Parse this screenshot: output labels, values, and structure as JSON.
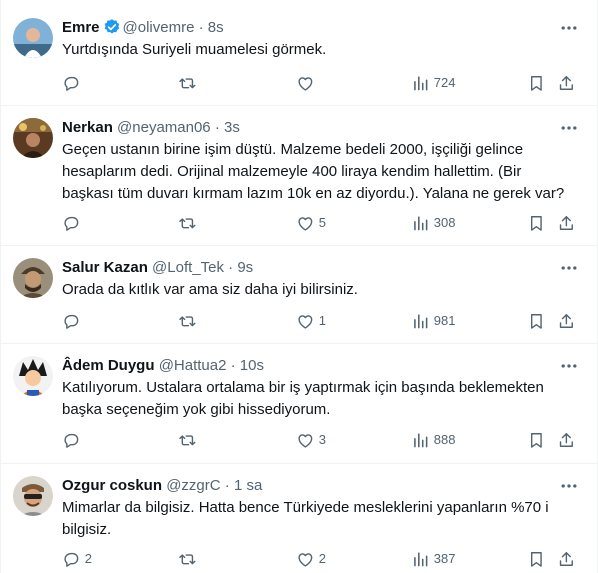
{
  "tweets": [
    {
      "name": "Emre",
      "verified": true,
      "handle": "@olivemre",
      "time": "8s",
      "text": "Yurtdışında Suriyeli muamelesi görmek.",
      "replies": "",
      "retweets": "",
      "likes": "",
      "views": "724"
    },
    {
      "name": "Nerkan",
      "verified": false,
      "handle": "@neyaman06",
      "time": "3s",
      "text": "Geçen ustanın birine işim düştü. Malzeme bedeli 2000, işçiliği gelince hesapların dedi. Orijinal malzemeyle 400 liraya kendim hallettim. (Bir başkası tüm duvarı kırmam lazım 10k en az diyordu.). Yalana ne gerek var?",
      "text_lines": [
        "Geçen ustanın birine işim düştü. Malzeme bedeli 2000, işçiliği gelince",
        "hesaplarım dedi. Orijinal malzemeyle 400 liraya kendim hallettim. (Bir",
        "başkası tüm duvarı kırmam lazım 10k en az diyordu.). Yalana ne gerek var?"
      ],
      "replies": "",
      "retweets": "",
      "likes": "5",
      "views": "308"
    },
    {
      "name": "Salur Kazan",
      "verified": false,
      "handle": "@Loft_Tek",
      "time": "9s",
      "text_lines": [
        "Orada da kıtlık var ama siz daha iyi bilirsiniz."
      ],
      "replies": "",
      "retweets": "",
      "likes": "1",
      "views": "981"
    },
    {
      "name": "Âdem Duygu",
      "verified": false,
      "handle": "@Hattua2",
      "time": "10s",
      "text_lines": [
        "Katılıyorum. Ustalara ortalama bir iş yaptırmak için başında beklemekten",
        "başka seçeneğim yok gibi hissediyorum."
      ],
      "replies": "",
      "retweets": "",
      "likes": "3",
      "views": "888"
    },
    {
      "name": "Ozgur coskun",
      "verified": false,
      "handle": "@zzgrC",
      "time": "1 sa",
      "text_lines": [
        "Mimarlar da bilgisiz. Hatta bence Türkiyede mesleklerini yapanların  %70 i",
        "bilgisiz."
      ],
      "replies": "2",
      "retweets": "",
      "likes": "2",
      "views": "387"
    }
  ],
  "dot": "·",
  "colors": {
    "text": "#0f1419",
    "secondary": "#536471",
    "verified": "#1d9bf0",
    "border": "#eff3f4"
  }
}
